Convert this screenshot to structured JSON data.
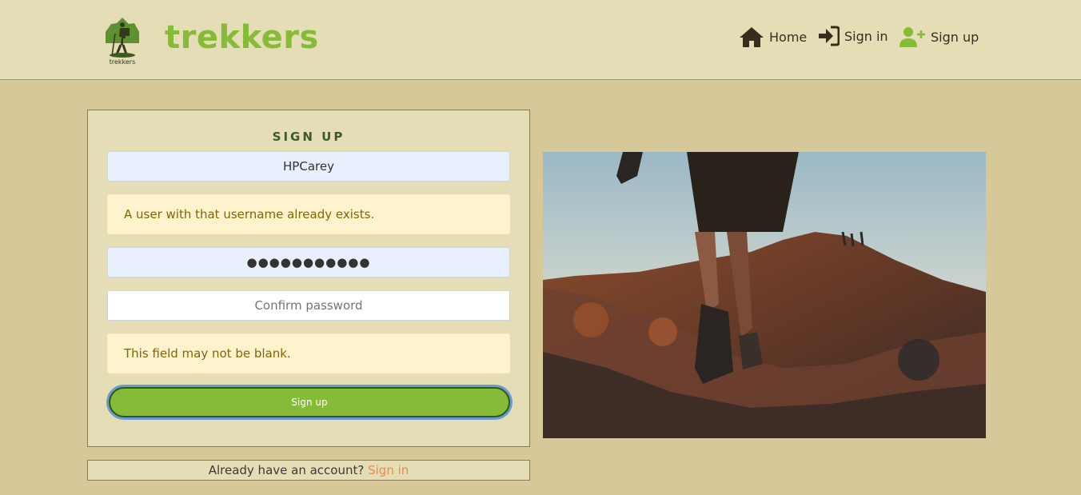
{
  "header": {
    "logo_caption": "trekkers",
    "brand": "trekkers",
    "nav": {
      "home": "Home",
      "signin": "Sign in",
      "signup": "Sign up"
    }
  },
  "form": {
    "title": "SIGN UP",
    "username_value": "HPCarey",
    "username_error": "A user with that username already exists.",
    "password_value": "●●●●●●●●●●●",
    "confirm_placeholder": "Confirm password",
    "confirm_error": "This field may not be blank.",
    "submit_label": "Sign up"
  },
  "footer": {
    "prompt": "Already have an account?",
    "link": "Sign in"
  },
  "colors": {
    "page_bg": "#d6c898",
    "header_bg": "#e5ddb6",
    "brand_green": "#85bb36",
    "link_orange": "#f08a4b",
    "alert_bg": "#fff3cd",
    "alert_text": "#856404"
  },
  "icons": {
    "home": "house-icon",
    "signin": "sign-in-arrow-icon",
    "signup": "user-plus-icon"
  }
}
